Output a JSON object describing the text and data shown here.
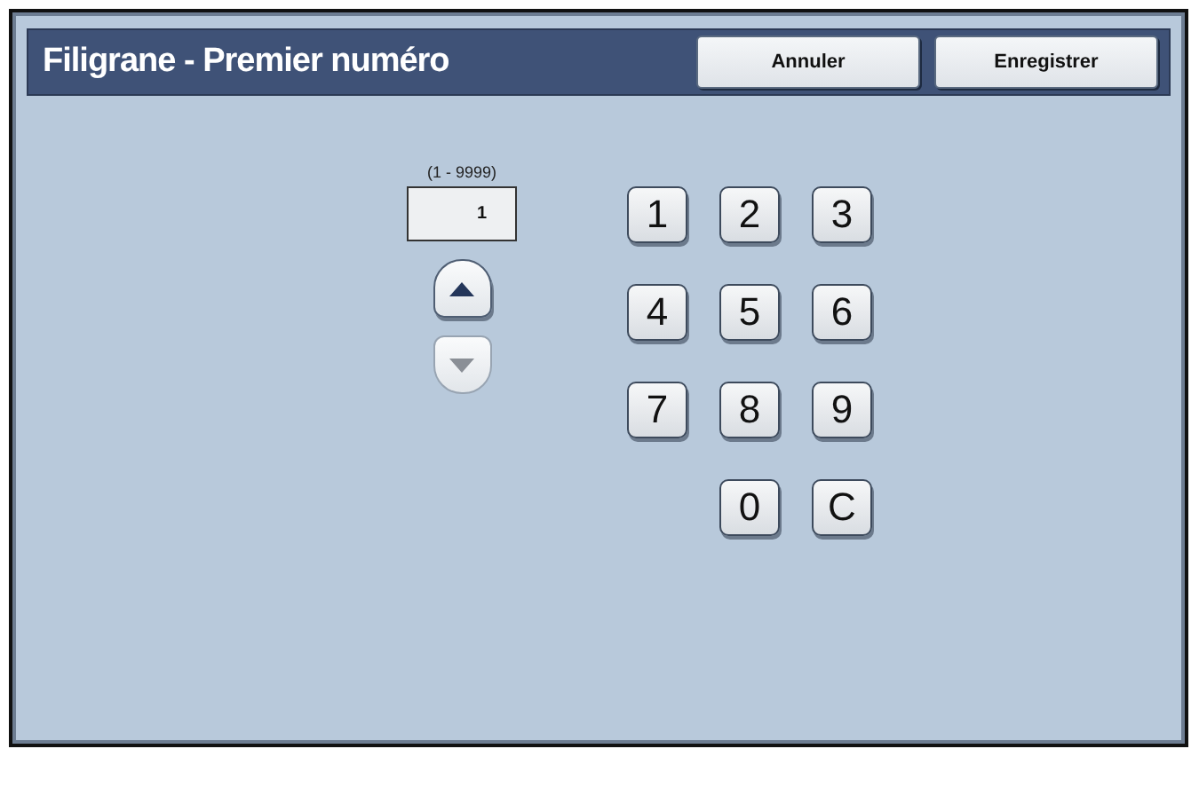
{
  "window": {
    "title": "Filigrane - Premier numéro"
  },
  "buttons": [
    {
      "label": "Annuler"
    },
    {
      "label": "Enregistrer"
    }
  ],
  "number_field": {
    "range": "(1 - 9999)",
    "value": "1"
  },
  "steppers": [
    {
      "kind": "up",
      "disabled": false
    },
    {
      "kind": "down",
      "disabled": true
    }
  ],
  "keypad": {
    "rows": [
      [
        "1",
        "2",
        "3"
      ],
      [
        "4",
        "5",
        "6"
      ],
      [
        "7",
        "8",
        "9"
      ],
      [
        "",
        "0",
        "C"
      ]
    ]
  }
}
